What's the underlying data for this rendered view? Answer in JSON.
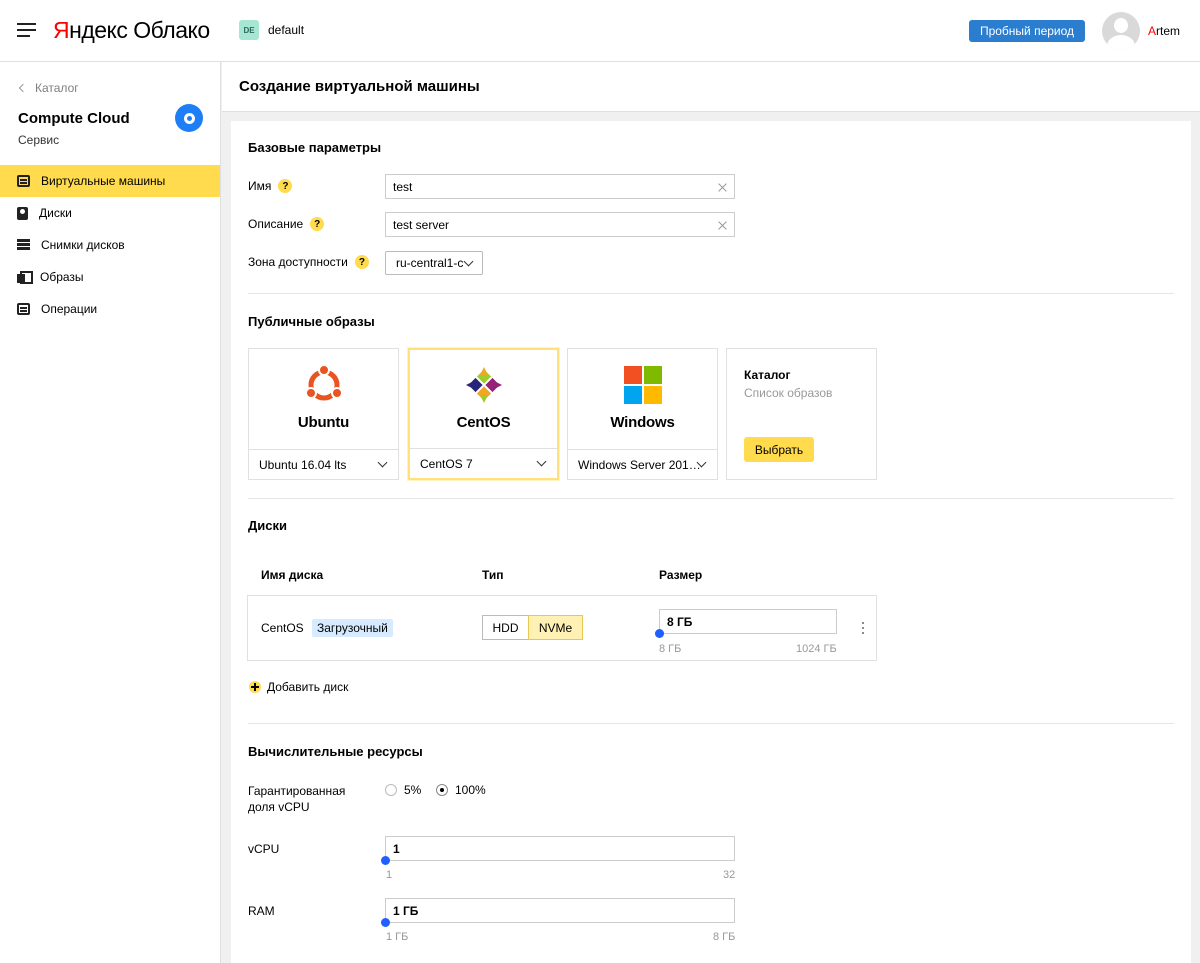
{
  "header": {
    "logo_brand_first": "Я",
    "logo_brand_rest": "ндекс",
    "logo_product": "Облако",
    "cloud_badge": "DE",
    "cloud_name": "default",
    "trial_button": "Пробный период",
    "user_first": "A",
    "user_rest": "rtem"
  },
  "sidebar": {
    "back_label": "Каталог",
    "service_title": "Compute Cloud",
    "service_subtitle": "Сервис",
    "items": [
      {
        "label": "Виртуальные машины",
        "icon": "vm-icon",
        "active": true
      },
      {
        "label": "Диски",
        "icon": "disk-icon",
        "active": false
      },
      {
        "label": "Снимки дисков",
        "icon": "snapshot-icon",
        "active": false
      },
      {
        "label": "Образы",
        "icon": "image-icon",
        "active": false
      },
      {
        "label": "Операции",
        "icon": "operations-icon",
        "active": false
      }
    ]
  },
  "page": {
    "title": "Создание виртуальной машины"
  },
  "basic": {
    "title": "Базовые параметры",
    "name_label": "Имя",
    "name_value": "test",
    "desc_label": "Описание",
    "desc_value": "test server",
    "zone_label": "Зона доступности",
    "zone_value": "ru-central1-c",
    "help_glyph": "?"
  },
  "images": {
    "title": "Публичные образы",
    "tiles": [
      {
        "name": "Ubuntu",
        "version": "Ubuntu 16.04 lts",
        "selected": false
      },
      {
        "name": "CentOS",
        "version": "CentOS 7",
        "selected": true
      },
      {
        "name": "Windows",
        "version": "Windows Server 201…",
        "selected": false
      }
    ],
    "catalog_title": "Каталог",
    "catalog_subtitle": "Список образов",
    "choose_button": "Выбрать"
  },
  "disks": {
    "title": "Диски",
    "col_name": "Имя диска",
    "col_type": "Тип",
    "col_size": "Размер",
    "row": {
      "name": "CentOS",
      "badge": "Загрузочный",
      "types": [
        "HDD",
        "NVMe"
      ],
      "selected_type": "NVMe",
      "size": "8 ГБ",
      "size_min": "8 ГБ",
      "size_max": "1024 ГБ"
    },
    "add_label": "Добавить диск"
  },
  "compute": {
    "title": "Вычислительные ресурсы",
    "vcpu_share_label_1": "Гарантированная",
    "vcpu_share_label_2": "доля vCPU",
    "share_options": [
      "5%",
      "100%"
    ],
    "share_selected": "100%",
    "vcpu_label": "vCPU",
    "vcpu_value": "1",
    "vcpu_min": "1",
    "vcpu_max": "32",
    "ram_label": "RAM",
    "ram_value": "1 ГБ",
    "ram_min": "1 ГБ",
    "ram_max": "8 ГБ"
  },
  "colors": {
    "accent_yellow": "#ffdb4d",
    "brand_blue": "#2a7dcf",
    "slider_blue": "#1f5fff"
  }
}
